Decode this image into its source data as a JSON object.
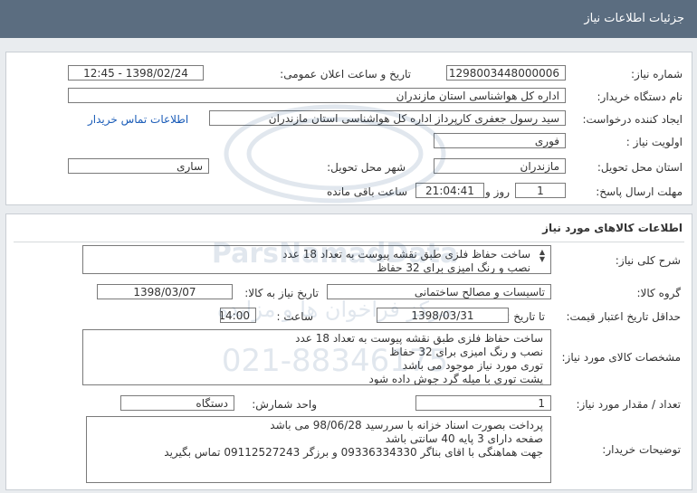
{
  "header": {
    "title": "جزئیات اطلاعات نیاز"
  },
  "info": {
    "need_number_label": "شماره نیاز:",
    "need_number": "1298003448000006",
    "announce_label": "تاریخ و ساعت اعلان عمومی:",
    "announce_value": "1398/02/24 - 12:45",
    "buyer_org_label": "نام دستگاه خریدار:",
    "buyer_org": "اداره کل هواشناسی استان مازندران",
    "requester_label": "ایجاد کننده درخواست:",
    "requester": "سید رسول  جعفری کارپرداز اداره کل هواشناسی استان مازندران",
    "contact_link": "اطلاعات تماس خریدار",
    "priority_label": "اولویت نیاز :",
    "priority": "فوری",
    "province_label": "استان محل تحویل:",
    "province": "مازندران",
    "city_label": "شهر محل تحویل:",
    "city": "ساری",
    "deadline_label": "مهلت ارسال پاسخ:",
    "days_value": "1",
    "days_label": "روز و",
    "time_value": "21:04:41",
    "remaining_label": "ساعت باقی مانده"
  },
  "goods": {
    "section_title": "اطلاعات کالاهای مورد نیاز",
    "general_desc_label": "شرح کلی نیاز:",
    "general_desc_lines": [
      "ساخت حفاظ فلزی طبق نقشه پیوست به تعداد 18 عدد",
      "نصب و رنگ امیزی برای 32 حفاظ"
    ],
    "group_label": "گروه کالا:",
    "group_value": "تاسیسات و مصالح ساختمانی",
    "need_date_label": "تاریخ نیاز به کالا:",
    "need_date": "1398/03/07",
    "price_valid_label": "حداقل تاریخ اعتبار قیمت:",
    "until_date_label": "تا تاریخ :",
    "until_date": "1398/03/31",
    "hour_label": "ساعت :",
    "hour_value": "14:00",
    "specs_label": "مشخصات کالای مورد نیاز:",
    "specs_lines": [
      "ساخت حفاظ فلزی طبق نقشه پیوست به تعداد 18 عدد",
      "نصب و رنگ امیزی برای 32 حفاظ",
      "توری مورد نیاز موجود می باشد",
      "پشت توری با میله گرد جوش داده شود"
    ],
    "qty_label": "تعداد / مقدار مورد نیاز:",
    "qty_value": "1",
    "unit_label": "واحد شمارش:",
    "unit_value": "دستگاه",
    "buyer_notes_label": "توضیحات خریدار:",
    "buyer_notes_lines": [
      "پرداخت بصورت اسناد خزانه با سررسید 98/06/28 می باشد",
      " صفحه دارای 3 پایه 40 سانتی باشد",
      "جهت هماهنگی با اقای بناگر 09336334330 و برزگر 09112527243 تماس  بگیرید"
    ]
  },
  "watermark": {
    "brand": "ParsNamadData",
    "tagline": "مرکز فراخوان ها و مزایده",
    "phone": "021-88346175"
  }
}
